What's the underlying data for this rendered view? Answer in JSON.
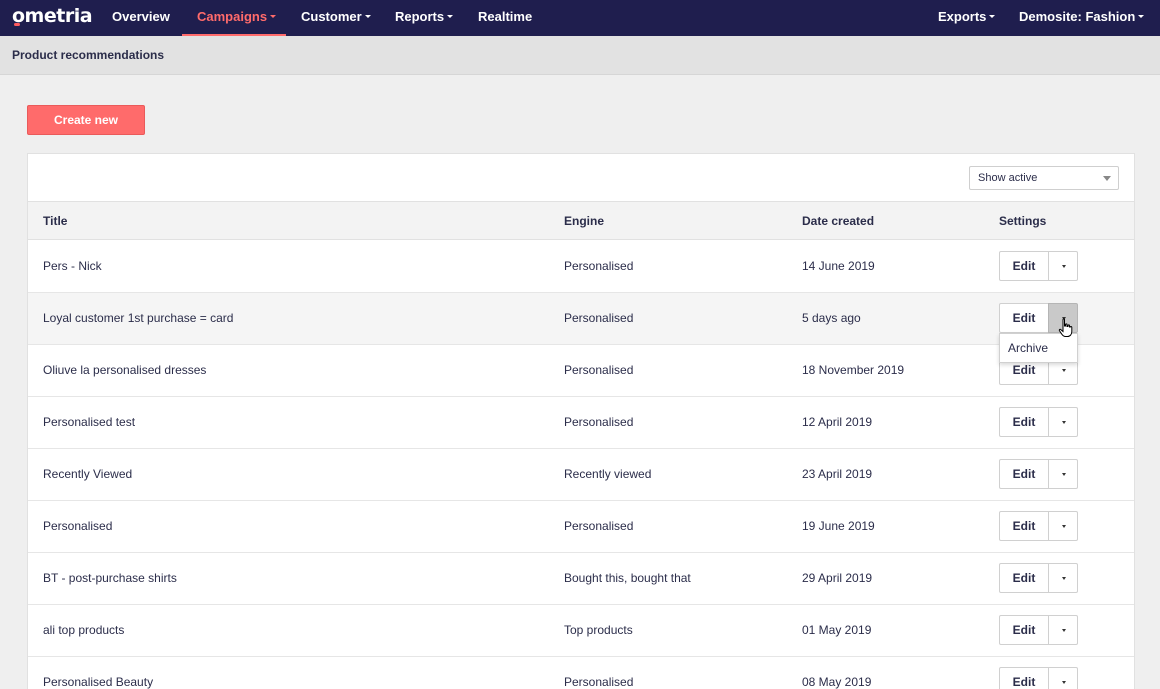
{
  "brand": {
    "name": "ometria",
    "accent": "#ff6b6b",
    "nav_bg": "#1f1e4e"
  },
  "nav": {
    "overview": "Overview",
    "campaigns": "Campaigns",
    "customer": "Customer",
    "reports": "Reports",
    "realtime": "Realtime",
    "exports": "Exports",
    "account": "Demosite: Fashion"
  },
  "page": {
    "title": "Product recommendations"
  },
  "actions": {
    "create_new": "Create new"
  },
  "filter": {
    "selected": "Show active"
  },
  "table": {
    "headers": {
      "title": "Title",
      "engine": "Engine",
      "date": "Date created",
      "settings": "Settings"
    },
    "edit_label": "Edit",
    "rows": [
      {
        "title": "Pers - Nick",
        "engine": "Personalised",
        "date": "14 June 2019"
      },
      {
        "title": "Loyal customer 1st purchase = card",
        "engine": "Personalised",
        "date": "5 days ago"
      },
      {
        "title": "Oliuve la personalised dresses",
        "engine": "Personalised",
        "date": "18 November 2019"
      },
      {
        "title": "Personalised test",
        "engine": "Personalised",
        "date": "12 April 2019"
      },
      {
        "title": "Recently Viewed",
        "engine": "Recently viewed",
        "date": "23 April 2019"
      },
      {
        "title": "Personalised",
        "engine": "Personalised",
        "date": "19 June 2019"
      },
      {
        "title": "BT - post-purchase shirts",
        "engine": "Bought this, bought that",
        "date": "29 April 2019"
      },
      {
        "title": "ali top products",
        "engine": "Top products",
        "date": "01 May 2019"
      },
      {
        "title": "Personalised Beauty",
        "engine": "Personalised",
        "date": "08 May 2019"
      }
    ]
  },
  "dropdown": {
    "archive": "Archive"
  },
  "icons": {
    "caret": "caret-down-icon",
    "cursor": "hand-pointer-icon"
  }
}
